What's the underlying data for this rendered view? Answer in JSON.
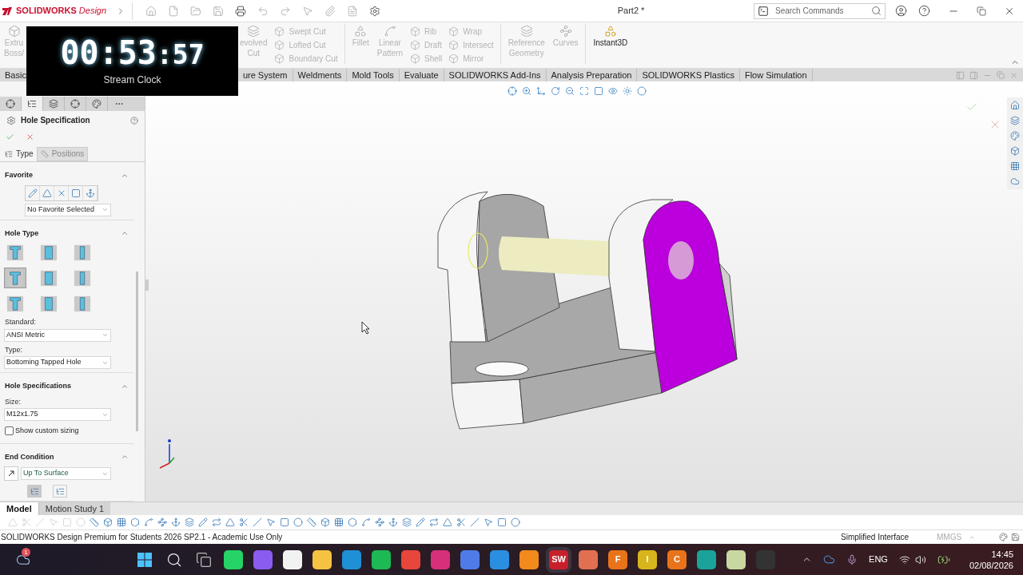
{
  "title_bar": {
    "brand": "**SOLIDWORKS** *Design*",
    "document_title": "Part2 *",
    "search": {
      "placeholder": "Search Commands"
    }
  },
  "ribbon": [
    {
      "kind": "large",
      "lines": [
        "Extru",
        "Boss/"
      ],
      "disabled": true
    },
    {
      "kind": "large",
      "lines": [
        "evolved",
        "Cut"
      ],
      "disabled": true
    },
    {
      "kind": "stack",
      "labels": [
        "Swept Cut",
        "Lofted Cut",
        "Boundary Cut"
      ],
      "disabled": true
    },
    {
      "kind": "divider"
    },
    {
      "kind": "large",
      "lines": [
        "Fillet"
      ],
      "disabled": true
    },
    {
      "kind": "large",
      "lines": [
        "Linear",
        "Pattern"
      ],
      "disabled": true
    },
    {
      "kind": "stack",
      "labels": [
        "Rib",
        "Draft",
        "Shell"
      ],
      "disabled": true
    },
    {
      "kind": "stack",
      "labels": [
        "Wrap",
        "Intersect",
        "Mirror"
      ],
      "disabled": true
    },
    {
      "kind": "divider"
    },
    {
      "kind": "large",
      "lines": [
        "Reference",
        "Geometry"
      ],
      "disabled": true
    },
    {
      "kind": "large",
      "lines": [
        "Curves"
      ],
      "disabled": true
    },
    {
      "kind": "divider"
    },
    {
      "kind": "large",
      "lines": [
        "Instant3D"
      ],
      "disabled": false
    }
  ],
  "tabs": [
    "Basic",
    "ure System",
    "Weldments",
    "Mold Tools",
    "Evaluate",
    "SOLIDWORKS Add-Ins",
    "Analysis Preparation",
    "SOLIDWORKS Plastics",
    "Flow Simulation"
  ],
  "clock": {
    "time": "00:53",
    "seconds": ":57",
    "caption": "Stream Clock"
  },
  "property_manager": {
    "panel_tabs": [
      {
        "selected": false
      },
      {
        "selected": true
      },
      {
        "selected": false
      },
      {
        "selected": false
      },
      {
        "selected": false
      }
    ],
    "title": "Hole Specification",
    "tabs": [
      {
        "label": "Type",
        "selected": true
      },
      {
        "label": "Positions",
        "selected": false
      }
    ],
    "sections": [
      {
        "title": "Favorite",
        "rows": [
          {
            "kind": "favorite_tools"
          },
          {
            "kind": "favorite_select",
            "value": "No Favorite Selected"
          }
        ]
      },
      {
        "title": "Hole Type",
        "rows": [
          {
            "kind": "hole_grid",
            "items": [
              {
                "selected": false
              },
              {
                "selected": false
              },
              {
                "selected": false
              },
              {
                "selected": true
              },
              {
                "selected": false
              },
              {
                "selected": false
              },
              {
                "selected": false
              },
              {
                "selected": false
              },
              {
                "selected": false
              }
            ]
          },
          {
            "kind": "label",
            "text": "Standard:"
          },
          {
            "kind": "select",
            "value": "ANSI Metric"
          },
          {
            "kind": "label",
            "text": "Type:"
          },
          {
            "kind": "select",
            "value": "Bottoming Tapped Hole"
          }
        ]
      },
      {
        "title": "Hole Specifications",
        "rows": [
          {
            "kind": "label",
            "text": "Size:"
          },
          {
            "kind": "select",
            "value": "M12x1.75"
          },
          {
            "kind": "checkbox",
            "label": "Show custom sizing",
            "checked": false
          }
        ]
      },
      {
        "title": "End Condition",
        "rows": [
          {
            "kind": "end_select",
            "value": "Up To Surface"
          },
          {
            "kind": "icon_pair"
          }
        ]
      }
    ]
  },
  "bottom_tabs": [
    {
      "label": "Model",
      "selected": true
    },
    {
      "label": "Motion Study 1",
      "selected": false
    }
  ],
  "status_bar": {
    "text": "SOLIDWORKS Design Premium for Students 2026 SP2.1 - Academic Use Only",
    "mode": "Simplified Interface",
    "units": "MMGS"
  },
  "taskbar": {
    "weather_badge": "1",
    "apps": [
      {
        "kind": "start"
      },
      {
        "kind": "search"
      },
      {
        "kind": "taskview"
      },
      {
        "kind": "tile",
        "color": "#25d366"
      },
      {
        "kind": "tile",
        "color": "#8a5cf0"
      },
      {
        "kind": "tile",
        "color": "#f2f2f2"
      },
      {
        "kind": "tile",
        "color": "#f5c242"
      },
      {
        "kind": "tile",
        "color": "#1f8fd6"
      },
      {
        "kind": "tile",
        "color": "#1db954"
      },
      {
        "kind": "tile",
        "color": "#e8453c"
      },
      {
        "kind": "tile",
        "color": "#d6307a"
      },
      {
        "kind": "tile",
        "color": "#4e7be8"
      },
      {
        "kind": "tile",
        "color": "#2a8fe0"
      },
      {
        "kind": "tile",
        "color": "#f28a1c"
      },
      {
        "kind": "tile",
        "color": "#c8202b",
        "glyph": "SW",
        "selected": true
      },
      {
        "kind": "tile",
        "color": "#e07050"
      },
      {
        "kind": "tile",
        "color": "#e8731a",
        "glyph": "F"
      },
      {
        "kind": "tile",
        "color": "#d8b51c",
        "glyph": "I"
      },
      {
        "kind": "tile",
        "color": "#e8731a",
        "glyph": "C"
      },
      {
        "kind": "tile",
        "color": "#1aa39a"
      },
      {
        "kind": "tile",
        "color": "#c8d8a0"
      },
      {
        "kind": "tile",
        "color": "#333333"
      }
    ],
    "tray": {
      "language": "ENG",
      "time": "14:45",
      "date": "02/08/2026"
    }
  }
}
